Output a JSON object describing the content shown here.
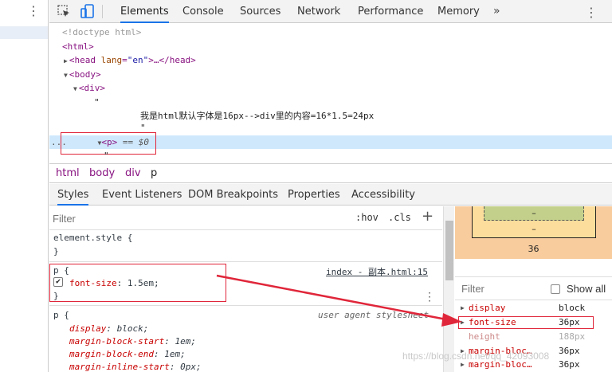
{
  "toolbar": {
    "tabs": [
      "Elements",
      "Console",
      "Sources",
      "Network",
      "Performance",
      "Memory"
    ],
    "more": "»"
  },
  "dom": {
    "doctype": "<!doctype html>",
    "html_open": "<html>",
    "head_open": "<head ",
    "head_attr": "lang",
    "head_attr_val": "\"en\"",
    "head_rest": ">…</head>",
    "body_open": "<body>",
    "div_open": "<div>",
    "quote": "\"",
    "text_content": "我是html默认字体是16px-->div里的内容=16*1.5=24px",
    "p_open": "<p>",
    "p_eq": " == $0",
    "ellipsis": "..."
  },
  "breadcrumb": [
    "html",
    "body",
    "div",
    "p"
  ],
  "subtabs": [
    "Styles",
    "Event Listeners",
    "DOM Breakpoints",
    "Properties",
    "Accessibility"
  ],
  "styles": {
    "filter_placeholder": "Filter",
    "hov": ":hov",
    "cls": ".cls",
    "plus": "+",
    "element_style": "element.style {",
    "close_brace": "}",
    "rule1": {
      "selector": "p {",
      "source": "index - 副本.html:15",
      "prop": "font-size",
      "value": ": 1.5em;",
      "checked": true
    },
    "rule2": {
      "selector": "p {",
      "source": "user agent stylesheet",
      "props": [
        {
          "name": "display",
          "value": ": block;"
        },
        {
          "name": "margin-block-start",
          "value": ": 1em;"
        },
        {
          "name": "margin-block-end",
          "value": ": 1em;"
        },
        {
          "name": "margin-inline-start",
          "value": ": 0px;"
        }
      ]
    }
  },
  "boxmodel": {
    "padding_value": "–",
    "border_value": "–",
    "margin_bottom": "36"
  },
  "computed": {
    "filter_label": "Filter",
    "show_all": "Show all",
    "rows": [
      {
        "prop": "display",
        "value": "block",
        "inherited": false
      },
      {
        "prop": "font-size",
        "value": "36px",
        "inherited": false
      },
      {
        "prop": "height",
        "value": "188px",
        "inherited": true
      },
      {
        "prop": "margin-bloc…",
        "value": "36px",
        "inherited": false
      },
      {
        "prop": "margin-bloc…",
        "value": "36px",
        "inherited": false
      }
    ]
  },
  "watermark": "https://blog.csdn.net/qq_42093008",
  "colors": {
    "accent": "#1a73e8",
    "annotation_red": "#e0263a",
    "tag": "#881280",
    "property": "#c80000"
  }
}
